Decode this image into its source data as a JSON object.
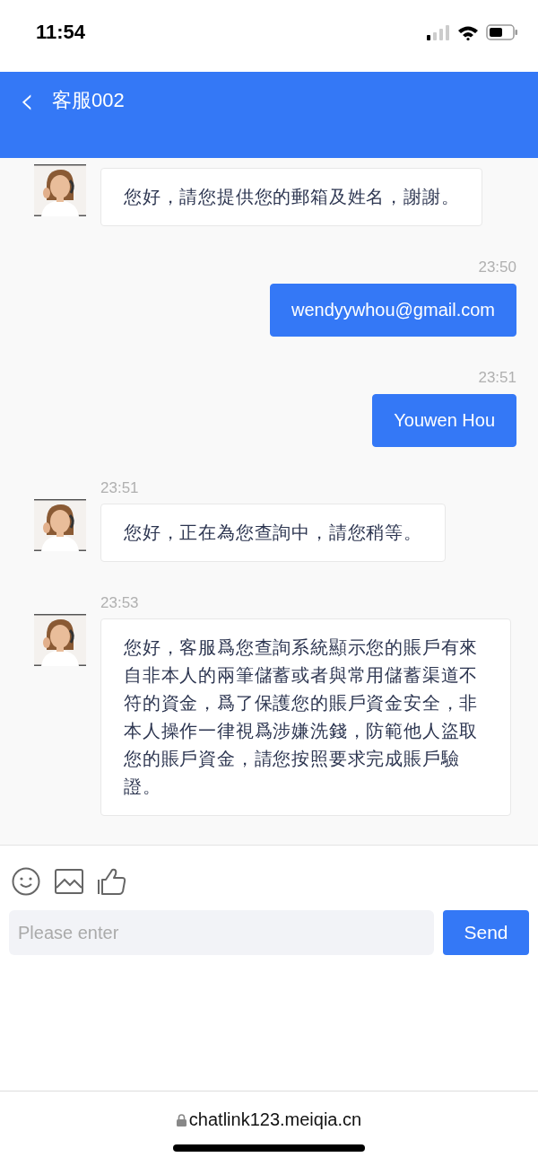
{
  "status_bar": {
    "time": "11:54"
  },
  "header": {
    "back_icon": "‹",
    "title": "客服002"
  },
  "messages": [
    {
      "kind": "agent",
      "text": "您好，請您提供您的郵箱及姓名，謝謝。"
    },
    {
      "kind": "user",
      "time": "23:50",
      "text": "wendyywhou@gmail.com"
    },
    {
      "kind": "user",
      "time": "23:51",
      "text": "Youwen Hou"
    },
    {
      "kind": "agent",
      "time": "23:51",
      "text": "您好，正在為您查詢中，請您稍等。"
    },
    {
      "kind": "agent",
      "time": "23:53",
      "text": "您好，客服爲您查詢系統顯示您的賬戶有來自非本人的兩筆儲蓄或者與常用儲蓄渠道不符的資金，爲了保護您的賬戶資金安全，非本人操作一律視爲涉嫌洗錢，防範他人盜取您的賬戶資金，請您按照要求完成賬戶驗證。"
    }
  ],
  "composer": {
    "placeholder": "Please enter",
    "send": "Send"
  },
  "browser_bar": {
    "url": "chatlink123.meiqia.cn"
  }
}
